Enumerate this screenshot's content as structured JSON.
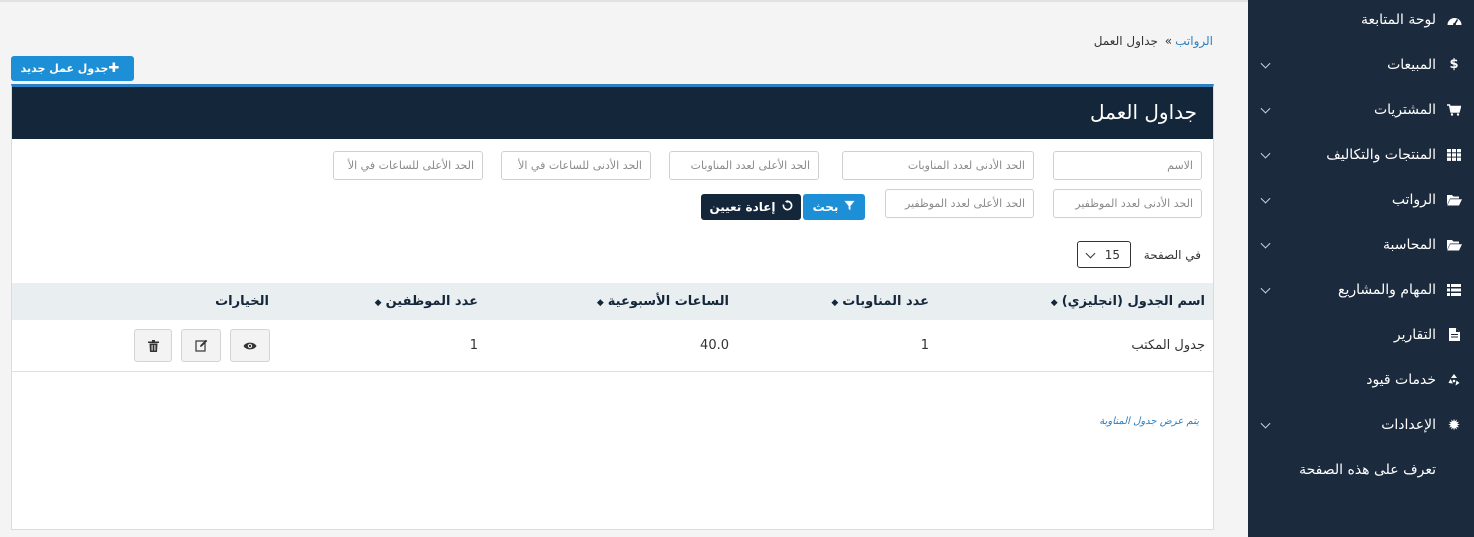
{
  "sidebar": {
    "items": [
      {
        "label": "لوحة المتابعة",
        "icon": "dashboard-icon",
        "chevron": false
      },
      {
        "label": "المبيعات",
        "icon": "dollar-icon",
        "chevron": true
      },
      {
        "label": "المشتريات",
        "icon": "cart-icon",
        "chevron": true
      },
      {
        "label": "المنتجات والتكاليف",
        "icon": "grid-icon",
        "chevron": true
      },
      {
        "label": "الرواتب",
        "icon": "folder-open-icon",
        "chevron": true
      },
      {
        "label": "المحاسبة",
        "icon": "folder-open-icon",
        "chevron": true
      },
      {
        "label": "المهام والمشاريع",
        "icon": "list-icon",
        "chevron": true
      },
      {
        "label": "التقارير",
        "icon": "file-icon",
        "chevron": false
      },
      {
        "label": "خدمات قيود",
        "icon": "recycle-icon",
        "chevron": false
      },
      {
        "label": "الإعدادات",
        "icon": "gear-icon",
        "chevron": true
      },
      {
        "label": "تعرف على هذه الصفحة",
        "icon": "",
        "chevron": false
      }
    ]
  },
  "breadcrumb": {
    "parent": "الرواتب",
    "separator": "»",
    "current": "جداول العمل"
  },
  "new_button": {
    "label": "جدول عمل جديد"
  },
  "card": {
    "title": "جداول العمل"
  },
  "filters": {
    "name": "الاسم",
    "min_shifts": "الحد الأدنى لعدد المناوبات",
    "max_shifts": "الحد الأعلى لعدد المناوبات",
    "min_hours": "الحد الأدنى للساعات في الأ",
    "max_hours": "الحد الأعلى للساعات في الأ",
    "min_employees": "الحد الأدنى لعدد الموظفير",
    "max_employees": "الحد الأعلى لعدد الموظفير",
    "search_label": "بحث",
    "reset_label": "إعادة تعيين"
  },
  "pagination": {
    "per_page_label": "في الصفحة",
    "per_page_value": "15"
  },
  "table": {
    "columns": [
      "اسم الجدول (انجليزي)",
      "عدد المناوبات",
      "الساعات الأسبوعية",
      "عدد الموظفين",
      "الخيارات"
    ],
    "rows": [
      {
        "name": "جدول المكتب",
        "shifts": "1",
        "weekly_hours": "40.0",
        "employees": "1"
      }
    ]
  },
  "note": "يتم عرض جدول المناوبة",
  "colors": {
    "sidebar": "#1b2a3c",
    "header": "#13263a",
    "accent": "#1d8fd6",
    "table_head": "#e9eef1"
  }
}
